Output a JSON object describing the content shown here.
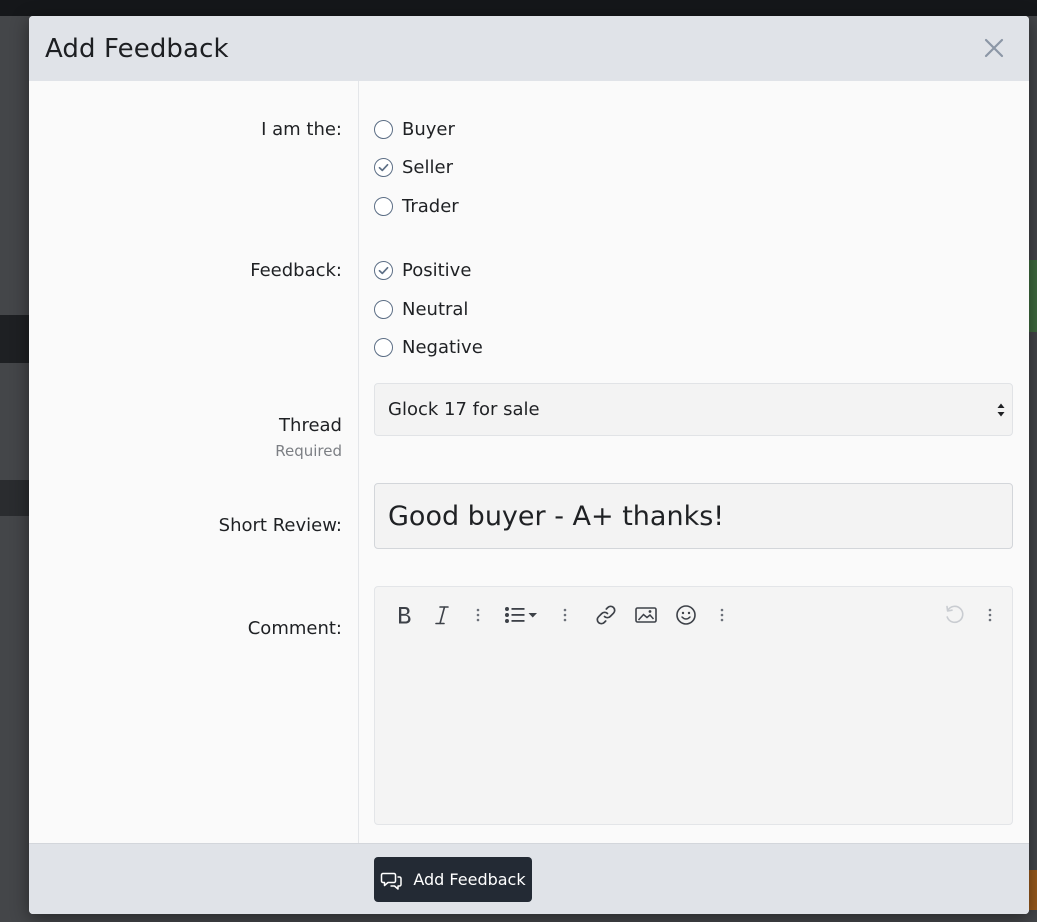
{
  "modal": {
    "title": "Add Feedback",
    "close_icon": "close-icon"
  },
  "role": {
    "label": "I am the:",
    "options": [
      {
        "label": "Buyer",
        "checked": false
      },
      {
        "label": "Seller",
        "checked": true
      },
      {
        "label": "Trader",
        "checked": false
      }
    ]
  },
  "feedback": {
    "label": "Feedback:",
    "options": [
      {
        "label": "Positive",
        "checked": true
      },
      {
        "label": "Neutral",
        "checked": false
      },
      {
        "label": "Negative",
        "checked": false
      }
    ]
  },
  "thread": {
    "label": "Thread",
    "hint": "Required",
    "selected": "Glock 17 for sale"
  },
  "short_review": {
    "label": "Short Review:",
    "value": "Good buyer - A+ thanks!"
  },
  "comment": {
    "label": "Comment:",
    "toolbar": [
      "bold-icon",
      "italic-icon",
      "more-icon",
      "list-icon",
      "more-icon",
      "link-icon",
      "image-icon",
      "smiley-icon",
      "more-icon",
      "undo-icon",
      "more-icon"
    ]
  },
  "footer": {
    "submit_label": "Add Feedback",
    "submit_icon": "comments-icon"
  },
  "colors": {
    "header_bg": "#e0e3e8",
    "radio_border": "#5d6f86",
    "submit_bg": "#232a34"
  }
}
